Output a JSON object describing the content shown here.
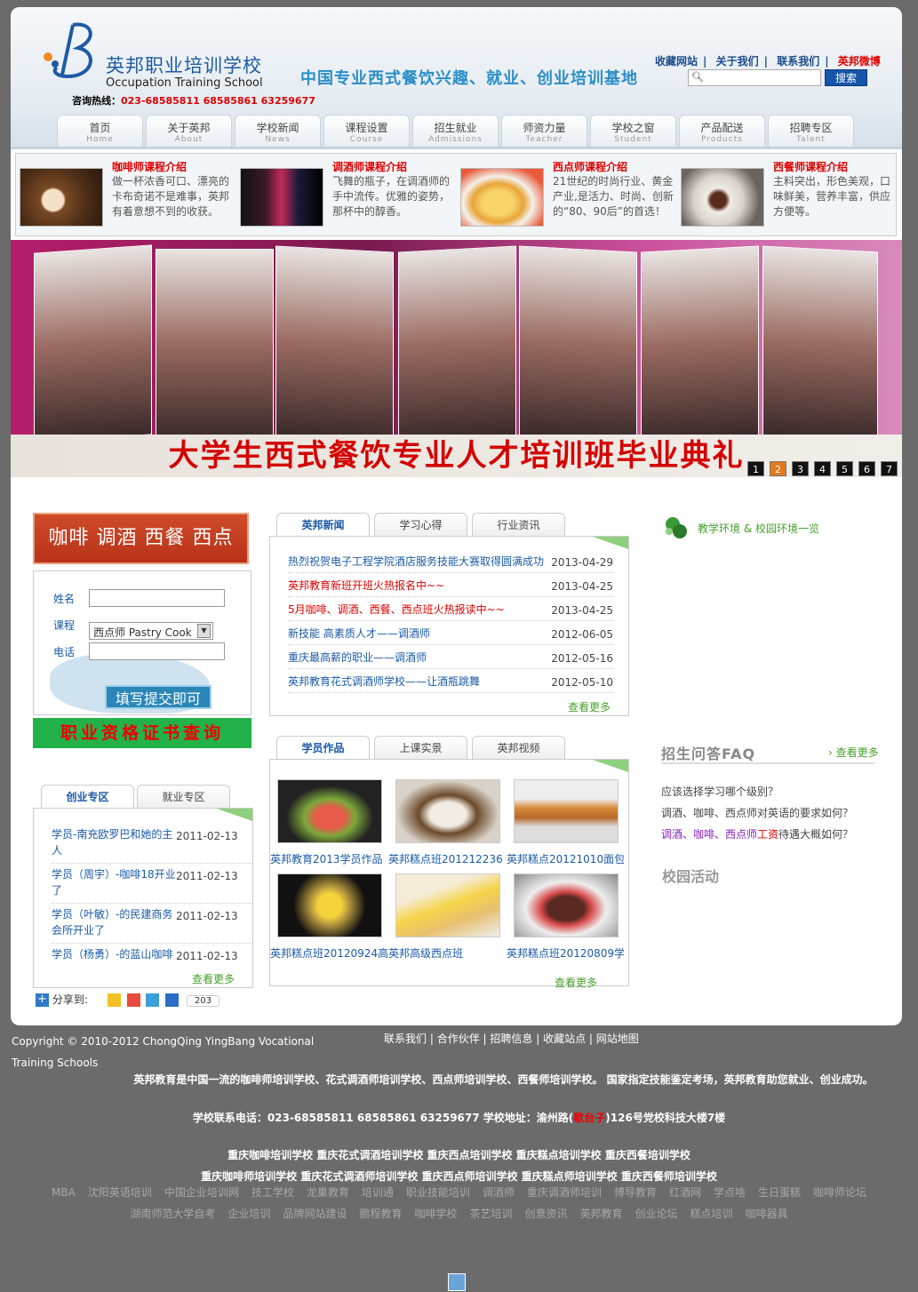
{
  "header": {
    "school_name_cn": "英邦职业培训学校",
    "school_name_en": "Occupation Training School",
    "hotline_label": "咨询热线：",
    "hotline_numbers": "023-68585811 68585861 63259677",
    "slogan": "中国专业西式餐饮兴趣、就业、创业培训基地",
    "top_links": [
      "收藏网站",
      "关于我们",
      "联系我们",
      "英邦微博"
    ],
    "separator": "|",
    "search_button": "搜索",
    "search_value": ""
  },
  "nav": [
    {
      "cn": "首页",
      "en": "Home"
    },
    {
      "cn": "关于英邦",
      "en": "About"
    },
    {
      "cn": "学校新闻",
      "en": "News"
    },
    {
      "cn": "课程设置",
      "en": "Course"
    },
    {
      "cn": "招生就业",
      "en": "Admissions"
    },
    {
      "cn": "师资力量",
      "en": "Teacher"
    },
    {
      "cn": "学校之窗",
      "en": "Student"
    },
    {
      "cn": "产品配送",
      "en": "Products"
    },
    {
      "cn": "招聘专区",
      "en": "Talent"
    }
  ],
  "courses": [
    {
      "title": "咖啡师课程介绍",
      "desc": "做一杯浓香可口、漂亮的卡布奇诺不是难事，英邦有着意想不到的收获。"
    },
    {
      "title": "调酒师课程介绍",
      "desc": "飞舞的瓶子，在调酒师的手中流传。优雅的姿势，那杯中的醇香。"
    },
    {
      "title": "西点师课程介绍",
      "desc": "21世纪的时尚行业、黄金产业,是活力、时尚、创新的“80、90后”的首选！"
    },
    {
      "title": "西餐师课程介绍",
      "desc": "主料突出，形色美观，口味鲜美，营养丰富，供应方便等。"
    }
  ],
  "banner": {
    "title": "大学生西式餐饮专业人才培训班毕业典礼",
    "pages": [
      "1",
      "2",
      "3",
      "4",
      "5",
      "6",
      "7"
    ],
    "active_page": "2"
  },
  "left": {
    "ad_text": "咖啡 调酒 西餐 西点",
    "form": {
      "name_label": "姓名",
      "course_label": "课程",
      "phone_label": "电话",
      "course_selected": "西点师 Pastry Cook",
      "submit": "填写提交即可"
    },
    "cert_text": "职业资格证书查询",
    "tabs": [
      "创业专区",
      "就业专区"
    ],
    "stories": [
      {
        "title": "学员-南充欧罗巴和她的主人",
        "date": "2011-02-13"
      },
      {
        "title": "学员（周宇）-咖啡18开业了",
        "date": "2011-02-13"
      },
      {
        "title": "学员（叶敏）-的民建商务会所开业了",
        "date": "2011-02-13"
      },
      {
        "title": "学员（杨勇）-的蓝山咖啡",
        "date": "2011-02-13"
      }
    ],
    "more": "查看更多",
    "share_label": "分享到:",
    "share_count": "203"
  },
  "news": {
    "tabs": [
      "英邦新闻",
      "学习心得",
      "行业资讯"
    ],
    "items": [
      {
        "title": "热烈祝贺电子工程学院酒店服务技能大赛取得圆满成功",
        "date": "2013-04-29",
        "hot": false
      },
      {
        "title": "英邦教育新班开班火热报名中~~",
        "date": "2013-04-25",
        "hot": true
      },
      {
        "title": "5月咖啡、调酒、西餐、西点班火热报读中~~",
        "date": "2013-04-25",
        "hot": true
      },
      {
        "title": "新技能 高素质人才——调酒师",
        "date": "2012-06-05",
        "hot": false
      },
      {
        "title": "重庆最高薪的职业——调酒师",
        "date": "2012-05-16",
        "hot": false
      },
      {
        "title": "英邦教育花式调酒师学校——让酒瓶跳舞",
        "date": "2012-05-10",
        "hot": false
      }
    ],
    "more": "查看更多"
  },
  "works": {
    "tabs": [
      "学员作品",
      "上课实景",
      "英邦视频"
    ],
    "items": [
      "英邦教育2013学员作品",
      "英邦糕点班201212236",
      "英邦糕点20121010面包",
      "英邦糕点班20120924高",
      "英邦高级西点班",
      "英邦糕点班20120809学"
    ],
    "more": "查看更多"
  },
  "right": {
    "env_title": "教学环境 & 校园环境一览",
    "faq_title": "招生问答FAQ",
    "faq_more": "查看更多",
    "faq": [
      "应该选择学习哪个级别？",
      "调酒、咖啡、西点师对英语的要求如何？"
    ],
    "faq3_part1": "调酒、咖啡、西点师",
    "faq3_part2": "工资",
    "faq3_part3": "待遇大概如何？",
    "campus_title": "校园活动"
  },
  "footer": {
    "copyright": "Copyright © 2010-2012 ChongQing YingBang Vocational Training Schools",
    "links": [
      "联系我们",
      "合作伙伴",
      "招聘信息",
      "收藏站点",
      "网站地图"
    ],
    "intro": "英邦教育是中国一流的咖啡师培训学校、花式调酒师培训学校、西点师培训学校、西餐师培训学校。 国家指定技能鉴定考场，英邦教育助您就业、创业成功。",
    "contact_part1": "学校联系电话：023-68585811 68585861 63259677 学校地址：渝州路(",
    "contact_part2": "歇台子",
    "contact_part3": ")126号党校科技大楼7楼",
    "keywords1": "重庆咖啡培训学校 重庆花式调酒培训学校 重庆西点培训学校 重庆糕点培训学校 重庆西餐培训学校",
    "keywords2": "重庆咖啡师培训学校 重庆花式调酒师培训学校 重庆西点师培训学校 重庆糕点师培训学校 重庆西餐师培训学校",
    "friends1": [
      "MBA",
      "沈阳英语培训",
      "中国企业培训网",
      "技工学校",
      "龙巢教育",
      "培训通",
      "职业技能培训",
      "调酒师",
      "重庆调酒师培训",
      "博导教育",
      "红酒网",
      "学点啥",
      "生日蛋糕",
      "咖啡师论坛"
    ],
    "friends2": [
      "湖南师范大学自考",
      "企业培训",
      "品牌网站建设",
      "鹏程教育",
      "咖啡学校",
      "茶艺培训",
      "创意资讯",
      "英邦教育",
      "创业论坛",
      "糕点培训",
      "咖啡器具"
    ]
  }
}
